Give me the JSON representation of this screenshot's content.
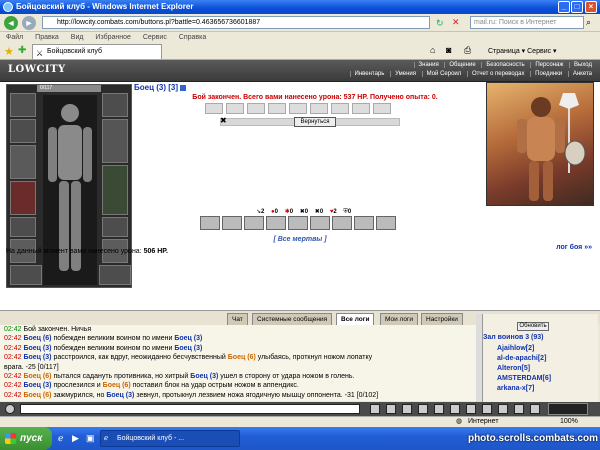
{
  "window": {
    "title": "Бойцовский клуб - Windows Internet Explorer"
  },
  "address": {
    "url": "http://lowcity.combats.com/buttons.pl?battle=0.463656736601887",
    "search_placeholder": "mail.ru: Поиск в Интернет"
  },
  "menu": [
    "Файл",
    "Правка",
    "Вид",
    "Избранное",
    "Сервис",
    "Справка"
  ],
  "browser_tab": {
    "label": "Бойцовский клуб",
    "tools": "Страница ▾   Сервис ▾"
  },
  "game_header": {
    "logo": "LOWCITY",
    "links_top": [
      "Знания",
      "Общение",
      "Безопасность",
      "Персонаж",
      "Выход"
    ],
    "links_bottom": [
      "Инвентарь",
      "Умения",
      "Мой Сероил",
      "Отчет о переводах",
      "Поединки",
      "Анкета"
    ]
  },
  "character": {
    "hp_label": "0/117",
    "name": "Боец (3) [3]"
  },
  "battle": {
    "message": "Бой закончен. Всего вами нанесено урона: 537 HP. Получено опыта: 0.",
    "return_button": "Вернуться",
    "stats": [
      "2",
      "0",
      "0",
      "0",
      "0",
      "2",
      "0"
    ],
    "all_dead": "[ Все мертвы ]",
    "damage_prefix": "На данный момент вами нанесено урона:",
    "damage_value": "506 HP.",
    "log_link": "лог боя »»"
  },
  "chat_tabs": [
    "Чат",
    "Системные сообщения",
    "Все логи",
    "Мои логи",
    "Настройки"
  ],
  "active_chat_tab": 2,
  "log": [
    {
      "time": "02:42",
      "text": "Бой закончен. Ничья"
    },
    {
      "time": "02:42",
      "actor": "Боец (6)",
      "text": "побежден великим воином по имени",
      "target": "Боец (3)"
    },
    {
      "time": "02:42",
      "actor": "Боец (3)",
      "text": "побежден великим воином по имени",
      "target": "Боец (3)"
    },
    {
      "time": "02:42",
      "actor": "Боец (3)",
      "text": "расстроился, как вдруг, неожиданно бесчувственный",
      "target": "Боец (6)",
      "tail": "улыбаясь, проткнул ножом лопатку"
    },
    {
      "time": "",
      "text": "врага. -25 [0/117]"
    },
    {
      "time": "02:42",
      "actor": "Боец (6)",
      "text": "пытался садануть противника, но хитрый",
      "target": "Боец (3)",
      "tail": "ушел в сторону от удара ножом в голень."
    },
    {
      "time": "02:42",
      "actor": "Боец (3)",
      "text": "прослезился и",
      "target": "Боец (6)",
      "tail": "поставил блок на удар острым ножом в аппендикс."
    },
    {
      "time": "02:42",
      "actor": "Боец (6)",
      "text": "зажмурился, но",
      "target": "Боец (3)",
      "tail": "зевнул, протыкнул лезвием ножа ягодичную мышцу оппонента. -31 [0/102]"
    }
  ],
  "right_panel": {
    "refresh_button": "Обновить",
    "hall_title": "Зал воинов 3 (93)",
    "users": [
      "Ajaihlow[2]",
      "al-de-apachi[2]",
      "Alteron[5]",
      "AMSTERDAM[6]",
      "arkana-x[7]"
    ]
  },
  "status_bar": {
    "zone": "Интернет",
    "zoom": "100%"
  },
  "taskbar": {
    "start": "пуск",
    "item": "Бойцовский клуб - ...",
    "watermark": "photo.scrolls.combats.com"
  },
  "colors": {
    "title_blue": "#0a4fd8",
    "name_blue": "#1133aa",
    "msg_red": "#cc0000",
    "time_green": "#008800",
    "enemy_orange": "#cc6600"
  }
}
